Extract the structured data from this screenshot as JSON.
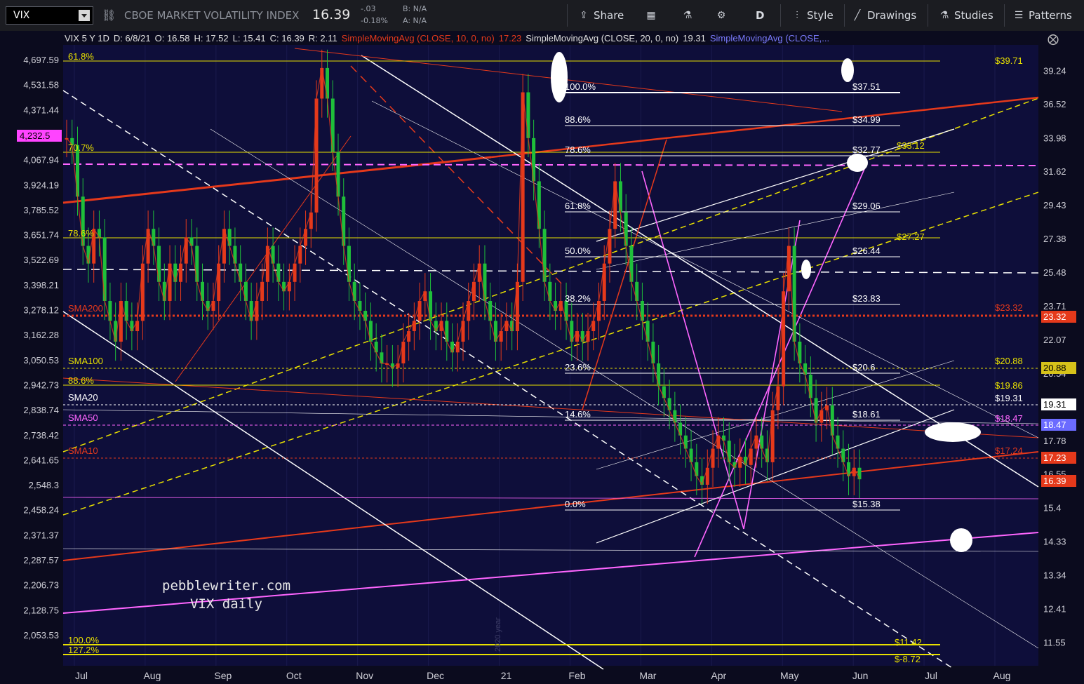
{
  "toolbar": {
    "symbol": "VIX",
    "name": "CBOE MARKET VOLATILITY INDEX",
    "last": "16.39",
    "change": "-.03",
    "change_pct": "-0.18%",
    "bid": "B: N/A",
    "ask": "A: N/A",
    "share_label": "Share",
    "period_label": "D",
    "style_label": "Style",
    "drawings_label": "Drawings",
    "studies_label": "Studies",
    "patterns_label": "Patterns",
    "icons": [
      "share-icon",
      "calendar-icon",
      "flask-icon",
      "gear-icon",
      "style-icon",
      "pencil-icon",
      "studies-icon",
      "patterns-icon"
    ]
  },
  "header": {
    "info": "VIX 5 Y 1D",
    "date": "D: 6/8/21",
    "open": "O: 16.58",
    "high": "H: 17.52",
    "low": "L: 15.41",
    "close": "C: 16.39",
    "range": "R: 2.11",
    "sma10": "SimpleMovingAvg (CLOSE, 10, 0, no)",
    "sma10_val": "17.23",
    "sma20": "SimpleMovingAvg (CLOSE, 20, 0, no)",
    "sma20_val": "19.31",
    "sma50": "SimpleMovingAvg (CLOSE,..."
  },
  "chart_data": {
    "type": "line",
    "title": "",
    "watermark": [
      "pebblewriter.com",
      "VIX daily"
    ],
    "year_marker": "2020 year",
    "x_labels": [
      "Jul",
      "Aug",
      "Sep",
      "Oct",
      "Nov",
      "Dec",
      "21",
      "Feb",
      "Mar",
      "Apr",
      "May",
      "Jun",
      "Jul",
      "Aug"
    ],
    "right_axis": {
      "ticks": [
        "39.24",
        "36.52",
        "33.98",
        "31.62",
        "29.43",
        "27.38",
        "25.48",
        "23.71",
        "22.07",
        "20.54",
        "19.11",
        "17.78",
        "16.55",
        "15.4",
        "14.33",
        "13.34",
        "12.41",
        "11.55"
      ],
      "scale": "log"
    },
    "left_axis": {
      "ticks": [
        "4,697.59",
        "4,531.58",
        "4,371.44",
        "4,216.97",
        "4,067.94",
        "3,924.19",
        "3,785.52",
        "3,651.74",
        "3,522.69",
        "3,398.21",
        "3,278.12",
        "3,162.28",
        "3,050.53",
        "2,942.73",
        "2,838.74",
        "2,738.42",
        "2,641.65",
        "2,548.3",
        "2,458.24",
        "2,371.37",
        "2,287.57",
        "2,206.73",
        "2,128.75",
        "2,053.53"
      ],
      "scale": "log",
      "highlight": "4,232.5"
    },
    "right_badges": [
      {
        "label": "23.32",
        "color": "#e5391b"
      },
      {
        "label": "20.88",
        "color": "#d6c21a"
      },
      {
        "label": "19.31",
        "color": "#ffffff"
      },
      {
        "label": "18.47",
        "color": "#6b6bff"
      },
      {
        "label": "17.23",
        "color": "#e5391b"
      },
      {
        "label": "16.39",
        "color": "#e5391b"
      }
    ],
    "left_fib_levels": [
      {
        "label": "61.8%",
        "color": "#e8e000"
      },
      {
        "label": "70.7%",
        "color": "#e8e000"
      },
      {
        "label": "78.6%",
        "color": "#e8e000"
      },
      {
        "label": "88.6%",
        "color": "#e8e000"
      },
      {
        "label": "100.0%",
        "color": "#e8e000"
      },
      {
        "label": "127.2%",
        "color": "#e8e000"
      }
    ],
    "left_sma_labels": [
      {
        "label": "SMA200",
        "color": "#e5391b"
      },
      {
        "label": "SMA100",
        "color": "#e8e000"
      },
      {
        "label": "SMA20",
        "color": "#ffffff"
      },
      {
        "label": "SMA50",
        "color": "#ff66ff"
      },
      {
        "label": "SMA10",
        "color": "#e5391b"
      }
    ],
    "mid_fib_levels": [
      {
        "pct": "100.0%",
        "price": "$37.51"
      },
      {
        "pct": "88.6%",
        "price": "$34.99"
      },
      {
        "pct": "78.6%",
        "price": "$32.77"
      },
      {
        "pct": "61.8%",
        "price": "$29.06"
      },
      {
        "pct": "50.0%",
        "price": "$26.44"
      },
      {
        "pct": "38.2%",
        "price": "$23.83"
      },
      {
        "pct": "23.6%",
        "price": "$20.6"
      },
      {
        "pct": "14.6%",
        "price": "$18.61"
      },
      {
        "pct": "0.0%",
        "price": "$15.38"
      }
    ],
    "right_price_labels": [
      {
        "label": "$39.71",
        "color": "#e8e000"
      },
      {
        "label": "$33.12",
        "color": "#e8e000"
      },
      {
        "label": "$27.27",
        "color": "#e8e000"
      },
      {
        "label": "$23.32",
        "color": "#e5391b"
      },
      {
        "label": "$20.88",
        "color": "#e8e000"
      },
      {
        "label": "$19.86",
        "color": "#e8e000"
      },
      {
        "label": "$19.31",
        "color": "#ffffff"
      },
      {
        "label": "$18.47",
        "color": "#ff66ff"
      },
      {
        "label": "$17.24",
        "color": "#e5391b"
      },
      {
        "label": "$11.42",
        "color": "#e8e000"
      },
      {
        "label": "$-8.72",
        "color": "#e8e000"
      }
    ],
    "series": [
      {
        "values": [
          34,
          33.5,
          30,
          27,
          26,
          28,
          27.5,
          24,
          23,
          22,
          24,
          23,
          22.5,
          23,
          26,
          28,
          27,
          25,
          24,
          26,
          25,
          26,
          27.5,
          27,
          25,
          24,
          23.5,
          24,
          26,
          28,
          27,
          26,
          25,
          24,
          23,
          24,
          25,
          27,
          26,
          25,
          24.5,
          25,
          26,
          27,
          28,
          29,
          37,
          39.5,
          37,
          33,
          30,
          27,
          25,
          24,
          23.5,
          23,
          22,
          21.5,
          21,
          21,
          20.8,
          21,
          22,
          22.5,
          23,
          24,
          24.5,
          23,
          22.5,
          23,
          22,
          21.5,
          22,
          23,
          24,
          25,
          26,
          24,
          23,
          22,
          22.5,
          23,
          22.5,
          25,
          37.5,
          34,
          31,
          28,
          25,
          24,
          23.5,
          24,
          23,
          22,
          22.5,
          22,
          22.5,
          23,
          24,
          26,
          28,
          31,
          29,
          27,
          25,
          24,
          23,
          22,
          21,
          20,
          19.5,
          19,
          18.5,
          18,
          17.5,
          17,
          16.5,
          16.2,
          16.8,
          17.5,
          18,
          17.8,
          17,
          16.8,
          17.2,
          16.9,
          17.5,
          18,
          17.5,
          17,
          19,
          20,
          24.5,
          27,
          22,
          21,
          20.5,
          19.5,
          18.5,
          19,
          19.2,
          18,
          17.5,
          17,
          16.5,
          16.8,
          16.39
        ]
      }
    ],
    "fib_high": 37.51,
    "fib_low": 15.38,
    "ylim": [
      11.0,
      41.5
    ]
  }
}
